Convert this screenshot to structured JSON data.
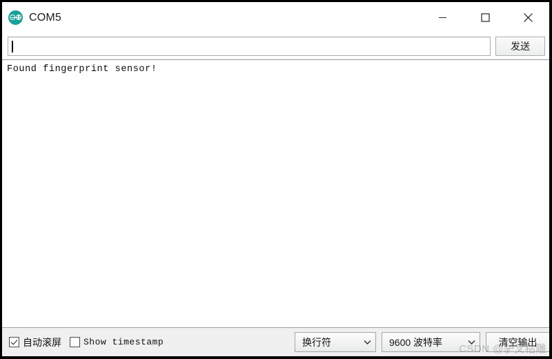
{
  "window": {
    "title": "COM5",
    "logo_icon": "arduino-logo-icon",
    "accent_color": "#1a9f9a",
    "controls": {
      "minimize_icon": "minimize-icon",
      "maximize_icon": "maximize-icon",
      "close_icon": "close-icon"
    }
  },
  "send_row": {
    "input_value": "",
    "input_placeholder": "",
    "send_label": "发送"
  },
  "console": {
    "lines": [
      "Found fingerprint sensor!"
    ]
  },
  "status_bar": {
    "autoscroll": {
      "label": "自动滚屏",
      "checked": true
    },
    "timestamp": {
      "label": "Show timestamp",
      "checked": false
    },
    "line_ending": {
      "value": "换行符",
      "chevron_icon": "chevron-down-icon"
    },
    "baud_rate": {
      "value": "9600 波特率",
      "chevron_icon": "chevron-down-icon"
    },
    "clear_label": "清空输出"
  },
  "watermark": {
    "text": "CSDN @驴叉枯雕"
  }
}
